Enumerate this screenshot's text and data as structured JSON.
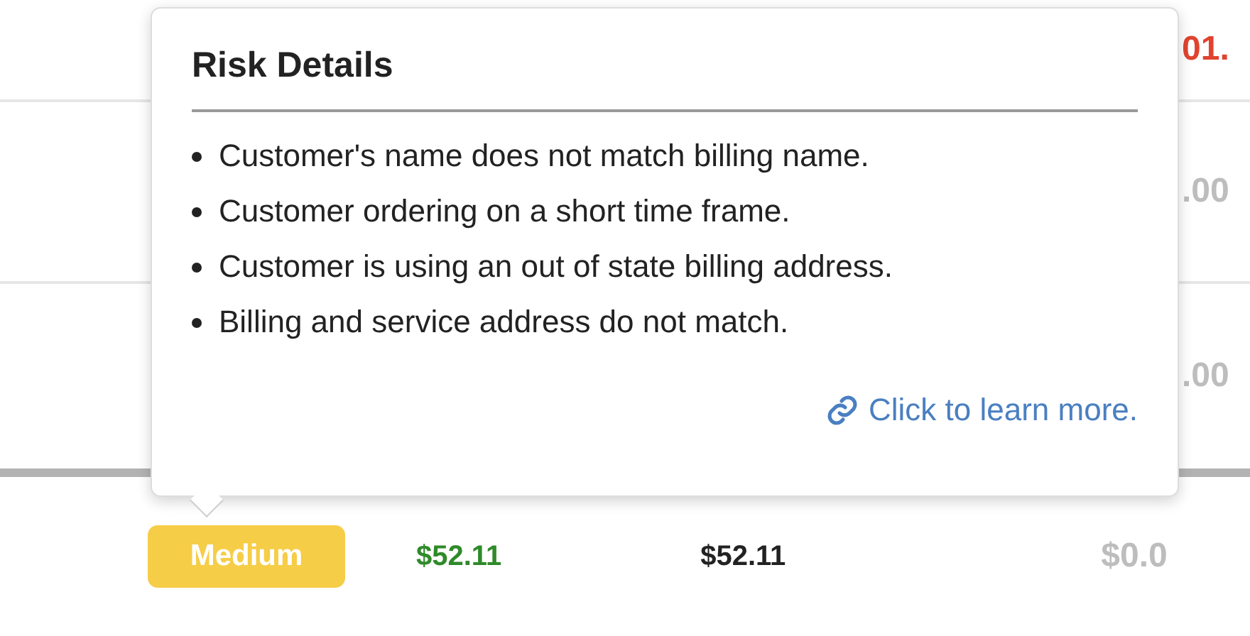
{
  "table": {
    "rows": [
      {
        "amount": "01.",
        "color": "#e0442f"
      },
      {
        "amount": ".00",
        "color": "#bdbdbd"
      },
      {
        "amount": ".00",
        "color": "#bdbdbd"
      }
    ],
    "summary_row": {
      "risk": {
        "label": "Medium",
        "color": "#f6cd47"
      },
      "paid": "$52.11",
      "total": "$52.11",
      "balance": "$0.0"
    }
  },
  "tooltip": {
    "title": "Risk Details",
    "items": [
      "Customer's name does not match billing name.",
      "Customer ordering on a short time frame.",
      "Customer is using an out of state billing address.",
      "Billing and service address do not match."
    ],
    "link": "Click to learn more."
  }
}
